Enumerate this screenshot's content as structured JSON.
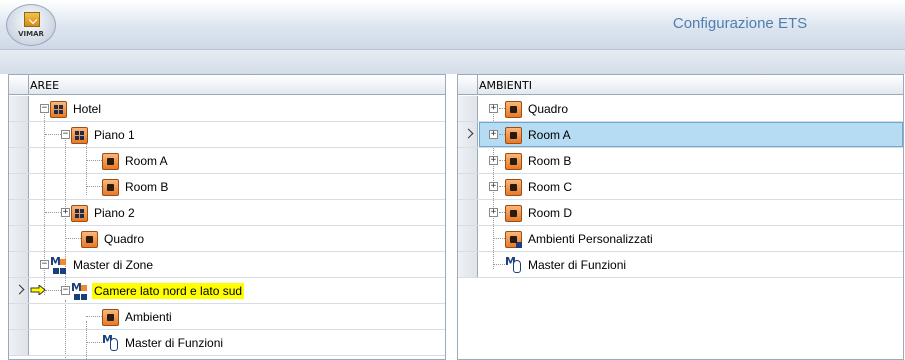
{
  "app": {
    "title": "Configurazione ETS",
    "logo_text": "VIMAR"
  },
  "left_grid": {
    "column": "AREE",
    "rows": [
      {
        "label": "Hotel",
        "icon": "floor-icon"
      },
      {
        "label": "Piano 1",
        "icon": "floor-icon"
      },
      {
        "label": "Room A",
        "icon": "room-icon"
      },
      {
        "label": "Room B",
        "icon": "room-icon"
      },
      {
        "label": "Piano 2",
        "icon": "floor-icon"
      },
      {
        "label": "Quadro",
        "icon": "room-icon"
      },
      {
        "label": "Master di Zone",
        "icon": "master-icon"
      },
      {
        "label": "Camere lato nord e lato sud",
        "icon": "master-icon",
        "selected": true
      },
      {
        "label": "Ambienti",
        "icon": "room-icon"
      },
      {
        "label": "Master di Funzioni",
        "icon": "function-icon"
      }
    ]
  },
  "right_grid": {
    "column": "AMBIENTI",
    "rows": [
      {
        "label": "Quadro",
        "icon": "room-icon"
      },
      {
        "label": "Room A",
        "icon": "room-icon",
        "selected": true
      },
      {
        "label": "Room B",
        "icon": "room-icon"
      },
      {
        "label": "Room C",
        "icon": "room-icon"
      },
      {
        "label": "Room D",
        "icon": "room-icon"
      },
      {
        "label": "Ambienti Personalizzati",
        "icon": "custom-icon"
      },
      {
        "label": "Master di Funzioni",
        "icon": "function-icon"
      }
    ]
  },
  "colors": {
    "selection_yellow": "#ffff00",
    "selection_blue": "#b5dcf2",
    "title_blue": "#4f7fb0",
    "room_orange": "#e8792a"
  }
}
